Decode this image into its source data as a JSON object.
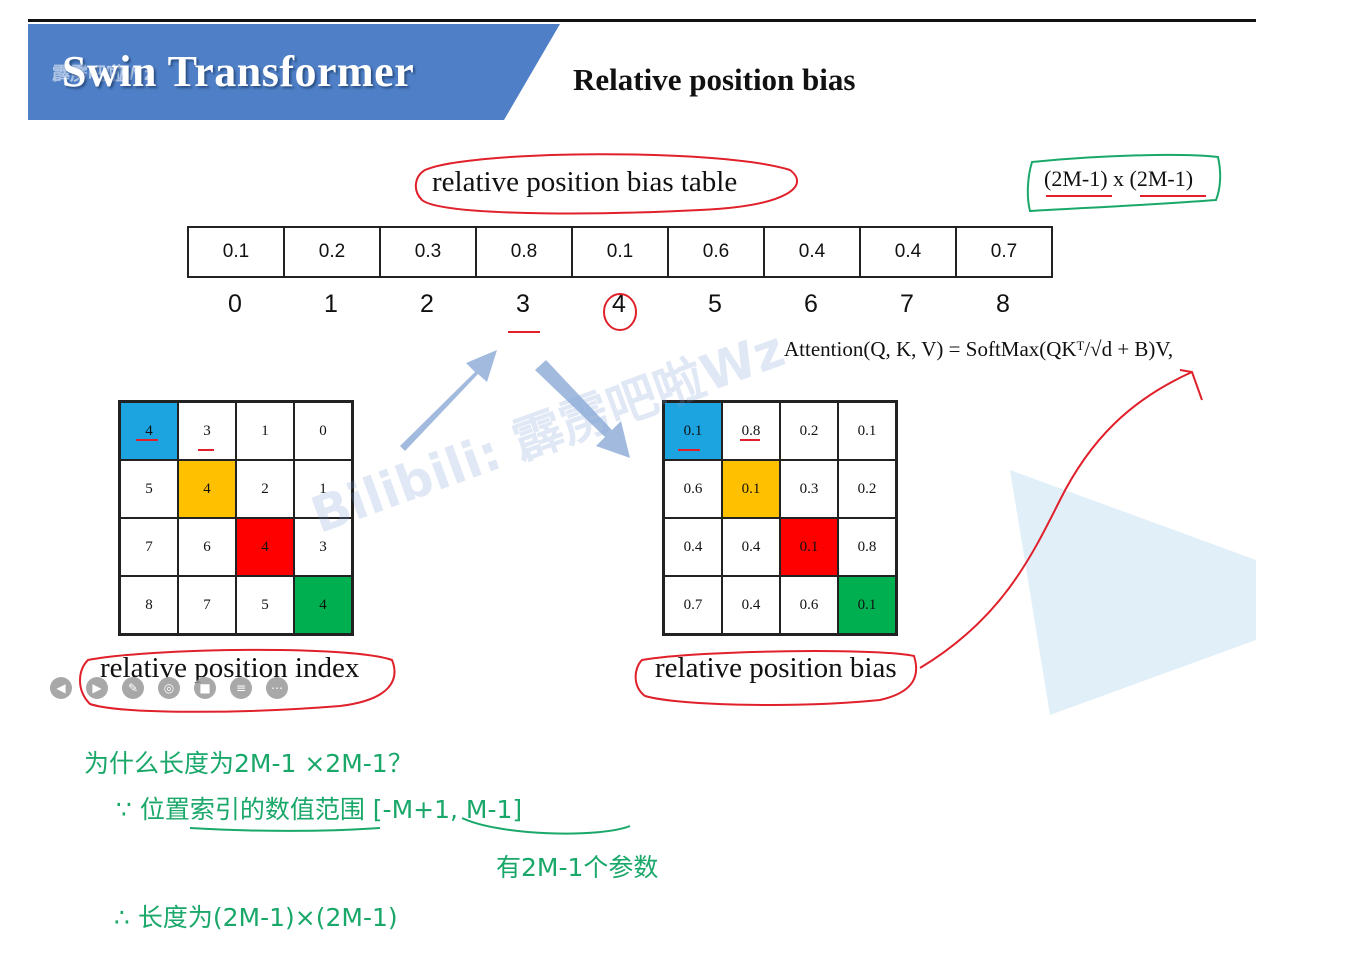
{
  "header": {
    "banner_title": "Swin Transformer",
    "banner_mark": "霹雳吧啦Wz",
    "slide_title": "Relative position bias"
  },
  "table": {
    "title": "relative position bias table",
    "dims": "(2M-1) x (2M-1)",
    "values": [
      "0.1",
      "0.2",
      "0.3",
      "0.8",
      "0.1",
      "0.6",
      "0.4",
      "0.4",
      "0.7"
    ],
    "indices": [
      "0",
      "1",
      "2",
      "3",
      "4",
      "5",
      "6",
      "7",
      "8"
    ]
  },
  "formula": "Attention(Q, K, V) = SoftMax(QKᵀ/√d + B)V,",
  "index_grid": {
    "label": "relative position index",
    "cells": [
      "4",
      "3",
      "1",
      "0",
      "5",
      "4",
      "2",
      "1",
      "7",
      "6",
      "4",
      "3",
      "8",
      "7",
      "5",
      "4"
    ]
  },
  "bias_grid": {
    "label": "relative position bias",
    "cells": [
      "0.1",
      "0.8",
      "0.2",
      "0.1",
      "0.6",
      "0.1",
      "0.3",
      "0.2",
      "0.4",
      "0.4",
      "0.1",
      "0.8",
      "0.7",
      "0.4",
      "0.6",
      "0.1"
    ]
  },
  "cell_colors": {
    "0": "#1ca4e0",
    "5": "#ffc000",
    "10": "#ff0000",
    "15": "#00b050"
  },
  "watermark": "Bilibili: 霹雳吧啦Wz",
  "colors": {
    "banner": "#4f7fc6",
    "annotation_red": "#e0202a",
    "annotation_green": "#1aa86a",
    "arrow": "#8aa9d6"
  },
  "toolbar": {
    "icons": [
      "prev-icon",
      "next-icon",
      "pen-icon",
      "focus-icon",
      "camera-icon",
      "subtitle-icon",
      "more-icon"
    ]
  },
  "notes": {
    "line1": "为什么长度为2M-1 ×2M-1？",
    "line2": "∵ 位置索引的数值范围 [-M+1, M-1]",
    "line3": "有2M-1个参数",
    "line4": "∴ 长度为(2M-1)×(2M-1)"
  }
}
